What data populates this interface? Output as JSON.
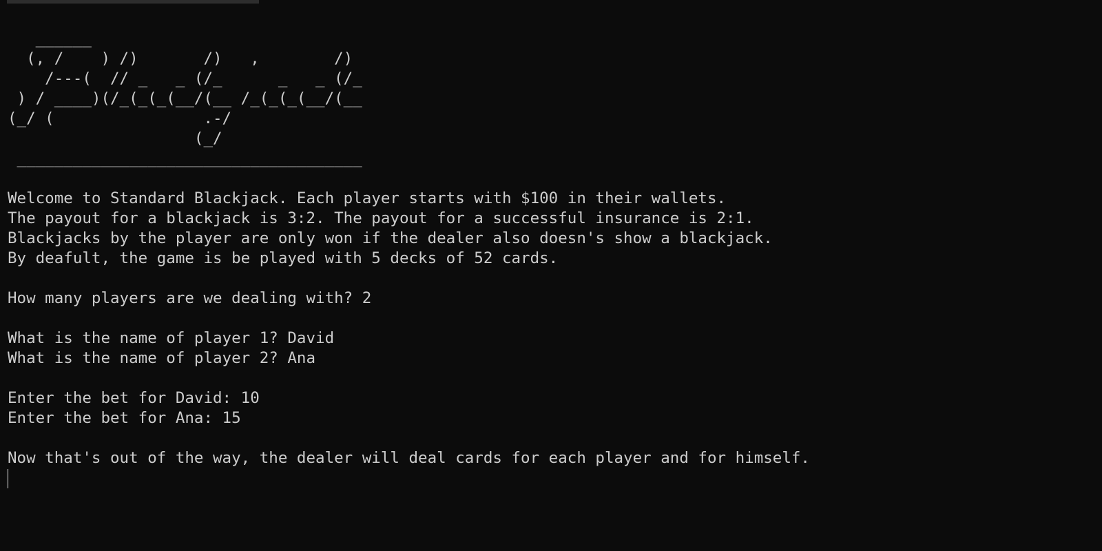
{
  "terminal": {
    "banner": [
      "   ______",
      "  (, /    ) /)       /)   ,        /)",
      "    /---(  // _   _ (/_      _   _ (/_",
      " ) / ____)(/_(_(_(__/(__ /_(_(_(__/(__",
      "(_/ (                .-/",
      "                    (_/",
      " _____________________________________"
    ],
    "intro": [
      "Welcome to Standard Blackjack. Each player starts with $100 in their wallets.",
      "The payout for a blackjack is 3:2. The payout for a successful insurance is 2:1.",
      "Blackjacks by the player are only won if the dealer also doesn's show a blackjack.",
      "By deafult, the game is be played with 5 decks of 52 cards."
    ],
    "players_prompt": "How many players are we dealing with? 2",
    "player_names": [
      "What is the name of player 1? David",
      "What is the name of player 2? Ana"
    ],
    "bets": [
      "Enter the bet for David: 10",
      "Enter the bet for Ana: 15"
    ],
    "deal_message": "Now that's out of the way, the dealer will deal cards for each player and for himself."
  }
}
